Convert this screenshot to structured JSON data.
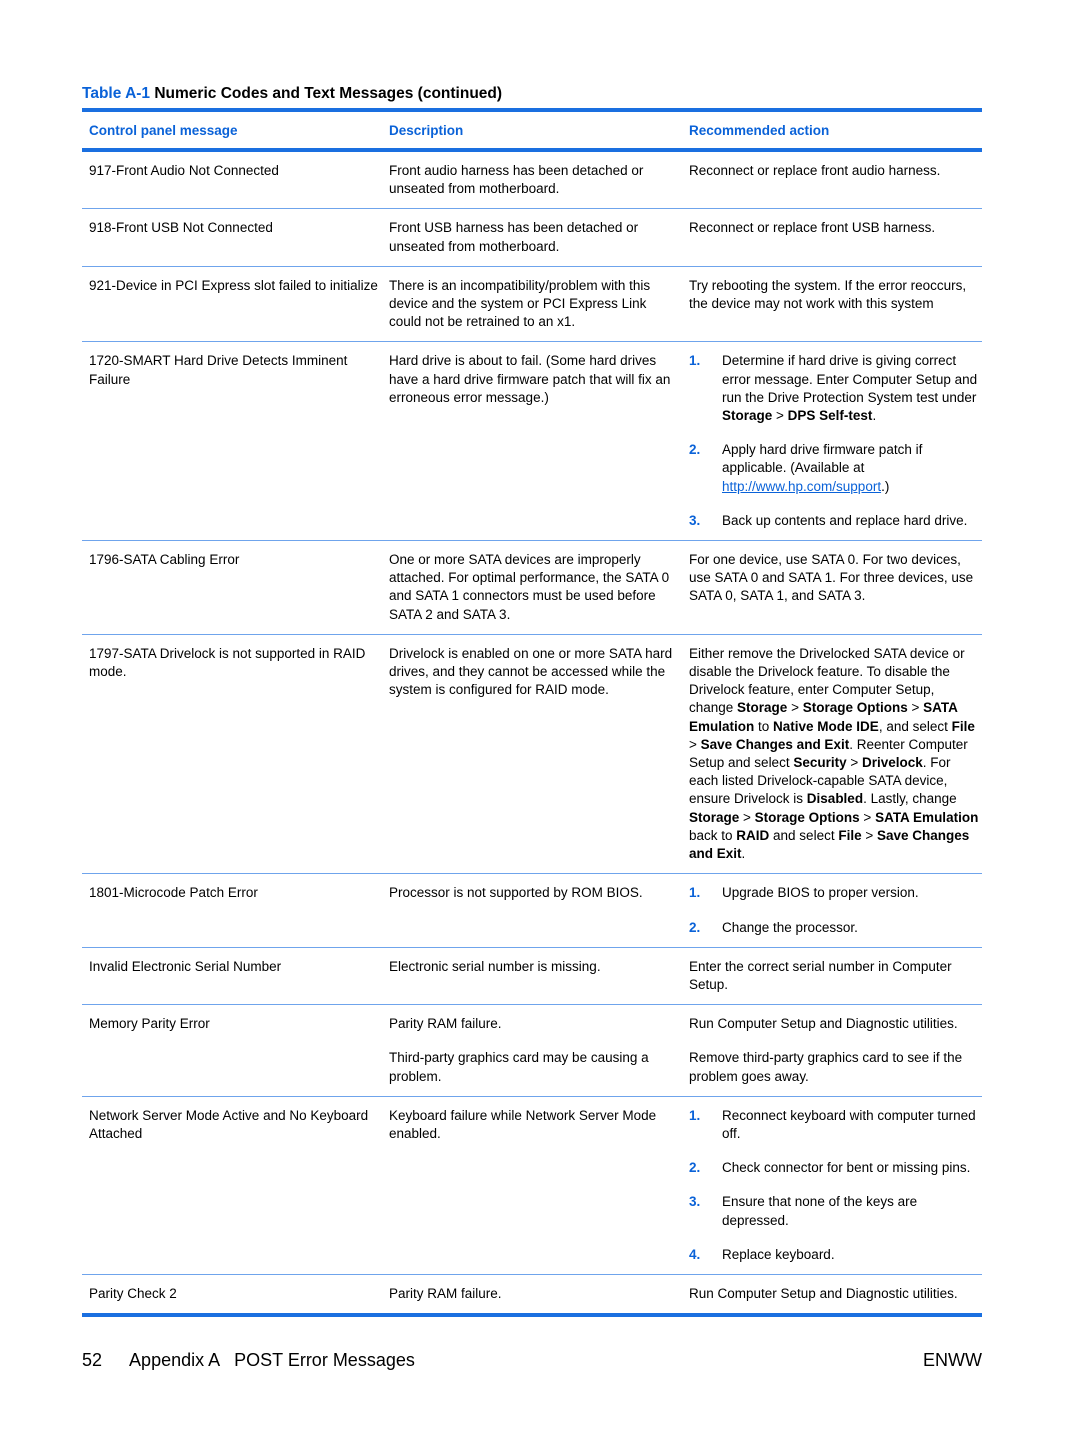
{
  "table": {
    "number": "Table A-1",
    "title": "Numeric Codes and Text Messages (continued)",
    "columns": [
      "Control panel message",
      "Description",
      "Recommended action"
    ],
    "rows": [
      {
        "message": "917-Front Audio Not Connected",
        "description": [
          "Front audio harness has been detached or unseated from motherboard."
        ],
        "action": {
          "type": "text",
          "segments": [
            {
              "t": "Reconnect or replace front audio harness."
            }
          ]
        }
      },
      {
        "message": "918-Front USB Not Connected",
        "description": [
          "Front USB harness has been detached or unseated from motherboard."
        ],
        "action": {
          "type": "text",
          "segments": [
            {
              "t": "Reconnect or replace front USB harness."
            }
          ]
        }
      },
      {
        "message": "921-Device in PCI Express slot failed to initialize",
        "description": [
          "There is an incompatibility/problem with this device and the system or PCI Express Link could not be retrained to an x1."
        ],
        "action": {
          "type": "text",
          "segments": [
            {
              "t": "Try rebooting the system. If the error reoccurs, the device may not work with this system"
            }
          ]
        }
      },
      {
        "message": "1720-SMART Hard Drive Detects Imminent Failure",
        "description": [
          "Hard drive is about to fail. (Some hard drives have a hard drive firmware patch that will fix an erroneous error message.)"
        ],
        "action": {
          "type": "steps",
          "steps": [
            {
              "n": "1.",
              "segments": [
                {
                  "t": "Determine if hard drive is giving correct error message. Enter Computer Setup and run the Drive Protection System test under "
                },
                {
                  "t": "Storage",
                  "b": true
                },
                {
                  "t": " > "
                },
                {
                  "t": "DPS Self-test",
                  "b": true
                },
                {
                  "t": "."
                }
              ]
            },
            {
              "n": "2.",
              "segments": [
                {
                  "t": "Apply hard drive firmware patch if applicable. (Available at "
                },
                {
                  "t": "http://www.hp.com/support",
                  "link": true
                },
                {
                  "t": ".)"
                }
              ]
            },
            {
              "n": "3.",
              "segments": [
                {
                  "t": "Back up contents and replace hard drive."
                }
              ]
            }
          ]
        }
      },
      {
        "message": "1796-SATA Cabling Error",
        "description": [
          "One or more SATA devices are improperly attached. For optimal performance, the SATA 0 and SATA 1 connectors must be used before SATA 2 and SATA 3."
        ],
        "action": {
          "type": "text",
          "segments": [
            {
              "t": "For one device, use SATA 0. For two devices, use SATA 0 and SATA 1. For three devices, use SATA 0, SATA 1, and SATA 3."
            }
          ]
        }
      },
      {
        "message": "1797-SATA Drivelock is not supported in RAID mode.",
        "description": [
          "Drivelock is enabled on one or more SATA hard drives, and they cannot be accessed while the system is configured for RAID mode."
        ],
        "action": {
          "type": "text",
          "segments": [
            {
              "t": "Either remove the Drivelocked SATA device or disable the Drivelock feature. To disable the Drivelock feature, enter Computer Setup, change "
            },
            {
              "t": "Storage",
              "b": true
            },
            {
              "t": " > "
            },
            {
              "t": "Storage Options",
              "b": true
            },
            {
              "t": " > "
            },
            {
              "t": "SATA Emulation",
              "b": true
            },
            {
              "t": " to "
            },
            {
              "t": "Native Mode IDE",
              "b": true
            },
            {
              "t": ", and select "
            },
            {
              "t": "File",
              "b": true
            },
            {
              "t": " > "
            },
            {
              "t": "Save Changes and Exit",
              "b": true
            },
            {
              "t": ". Reenter Computer Setup and select "
            },
            {
              "t": "Security",
              "b": true
            },
            {
              "t": " > "
            },
            {
              "t": "Drivelock",
              "b": true
            },
            {
              "t": ". For each listed Drivelock-capable SATA device, ensure Drivelock is "
            },
            {
              "t": "Disabled",
              "b": true
            },
            {
              "t": ". Lastly, change "
            },
            {
              "t": "Storage",
              "b": true
            },
            {
              "t": " > "
            },
            {
              "t": "Storage Options",
              "b": true
            },
            {
              "t": " > "
            },
            {
              "t": "SATA Emulation",
              "b": true
            },
            {
              "t": " back to "
            },
            {
              "t": "RAID",
              "b": true
            },
            {
              "t": " and select "
            },
            {
              "t": "File",
              "b": true
            },
            {
              "t": " > "
            },
            {
              "t": "Save Changes and Exit",
              "b": true
            },
            {
              "t": "."
            }
          ]
        }
      },
      {
        "message": "1801-Microcode Patch Error",
        "description": [
          "Processor is not supported by ROM BIOS."
        ],
        "action": {
          "type": "steps",
          "steps": [
            {
              "n": "1.",
              "segments": [
                {
                  "t": "Upgrade BIOS to proper version."
                }
              ]
            },
            {
              "n": "2.",
              "segments": [
                {
                  "t": "Change the processor."
                }
              ]
            }
          ]
        }
      },
      {
        "message": "Invalid Electronic Serial Number",
        "description": [
          "Electronic serial number is missing."
        ],
        "action": {
          "type": "text",
          "segments": [
            {
              "t": "Enter the correct serial number in Computer Setup."
            }
          ]
        }
      },
      {
        "message": "Memory Parity Error",
        "description": [
          "Parity RAM failure.",
          "Third-party graphics card may be causing a problem."
        ],
        "action": {
          "type": "paras",
          "paras": [
            "Run Computer Setup and Diagnostic utilities.",
            "Remove third-party graphics card to see if the problem goes away."
          ]
        }
      },
      {
        "message": "Network Server Mode Active and No Keyboard Attached",
        "description": [
          "Keyboard failure while Network Server Mode enabled."
        ],
        "action": {
          "type": "steps",
          "steps": [
            {
              "n": "1.",
              "segments": [
                {
                  "t": "Reconnect keyboard with computer turned off."
                }
              ]
            },
            {
              "n": "2.",
              "segments": [
                {
                  "t": "Check connector for bent or missing pins."
                }
              ]
            },
            {
              "n": "3.",
              "segments": [
                {
                  "t": "Ensure that none of the keys are depressed."
                }
              ]
            },
            {
              "n": "4.",
              "segments": [
                {
                  "t": "Replace keyboard."
                }
              ]
            }
          ]
        }
      },
      {
        "message": "Parity Check 2",
        "description": [
          "Parity RAM failure."
        ],
        "action": {
          "type": "text",
          "segments": [
            {
              "t": "Run Computer Setup and Diagnostic utilities."
            }
          ]
        }
      }
    ]
  },
  "footer": {
    "page_number": "52",
    "section": "Appendix A   POST Error Messages",
    "locale_code": "ENWW"
  }
}
